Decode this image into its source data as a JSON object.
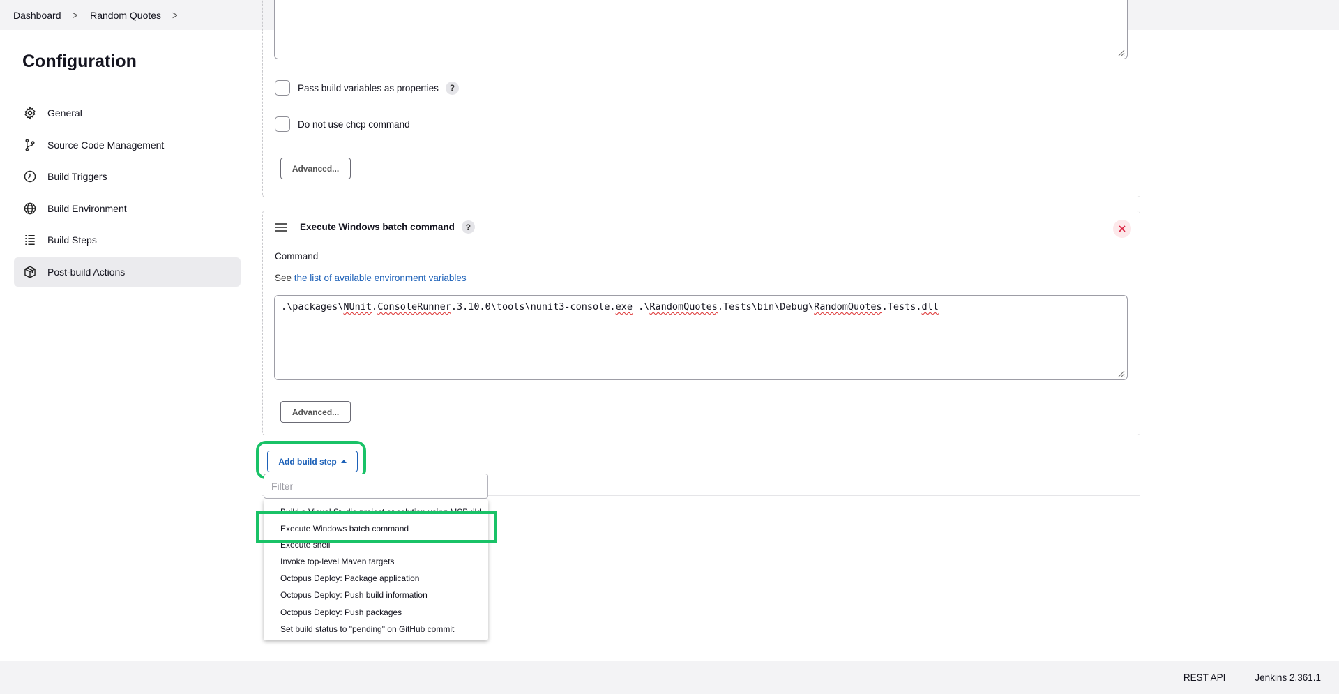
{
  "breadcrumb": {
    "items": [
      "Dashboard",
      "Random Quotes"
    ]
  },
  "sidebar": {
    "title": "Configuration",
    "items": [
      {
        "label": "General",
        "icon": "gear-icon"
      },
      {
        "label": "Source Code Management",
        "icon": "branch-icon"
      },
      {
        "label": "Build Triggers",
        "icon": "clock-icon"
      },
      {
        "label": "Build Environment",
        "icon": "globe-icon"
      },
      {
        "label": "Build Steps",
        "icon": "list-icon"
      },
      {
        "label": "Post-build Actions",
        "icon": "package-icon",
        "active": true
      }
    ]
  },
  "step_prev": {
    "checkbox_pass_vars": "Pass build variables as properties",
    "checkbox_chcp": "Do not use chcp command",
    "advanced_label": "Advanced..."
  },
  "step_batch": {
    "title": "Execute Windows batch command",
    "command_label": "Command",
    "see_prefix": "See ",
    "see_link": "the list of available environment variables",
    "command_value": {
      "p1": ".\\packages\\",
      "w1": "NUnit",
      "p2": ".",
      "w2": "ConsoleRunner",
      "p3": ".3.10.0\\tools\\nunit3-console.",
      "w3": "exe",
      "p4": " .\\",
      "w4": "RandomQuotes",
      "p5": ".Tests\\bin\\Debug\\",
      "w5": "RandomQuotes",
      "p6": ".Tests.",
      "w6": "dll"
    },
    "advanced_label": "Advanced..."
  },
  "add_step": {
    "button_label": "Add build step",
    "filter_placeholder": "Filter",
    "menu": [
      "Build a Visual Studio project or solution using MSBuild",
      "Execute Windows batch command",
      "Execute shell",
      "Invoke top-level Maven targets",
      "Octopus Deploy: Package application",
      "Octopus Deploy: Push build information",
      "Octopus Deploy: Push packages",
      "Set build status to \"pending\" on GitHub commit"
    ]
  },
  "help_mark": "?",
  "footer": {
    "rest_api": "REST API",
    "version": "Jenkins 2.361.1"
  },
  "colors": {
    "highlight": "#19c267",
    "link": "#1d61b8",
    "delete": "#d9213f"
  }
}
